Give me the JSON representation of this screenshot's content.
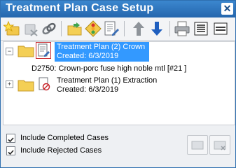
{
  "window": {
    "title": "Treatment Plan Case Setup",
    "close_glyph": "✕"
  },
  "toolbar": {
    "buttons": [
      {
        "name": "new-case-icon"
      },
      {
        "name": "delete-case-icon"
      },
      {
        "name": "link-icon"
      },
      {
        "name": "open-folder-icon"
      },
      {
        "name": "traffic-light-icon"
      },
      {
        "name": "edit-document-icon"
      },
      {
        "name": "move-up-icon"
      },
      {
        "name": "move-down-icon"
      },
      {
        "name": "print-icon"
      },
      {
        "name": "list-view-icon"
      },
      {
        "name": "collapse-icon"
      }
    ]
  },
  "tree": {
    "nodes": [
      {
        "title": "Treatment Plan (2) Crown",
        "created": "Created: 6/3/2019",
        "expanded": true,
        "selected": true,
        "children": [
          {
            "label": "D2750: Crown-porc fuse high noble mtl [#21 ]"
          }
        ]
      },
      {
        "title": "Treatment Plan (1) Extraction",
        "created": "Created: 6/3/2019",
        "expanded": false,
        "selected": false
      }
    ]
  },
  "footer": {
    "include_completed": {
      "label": "Include Completed Cases",
      "checked": true
    },
    "include_rejected": {
      "label": "Include Rejected Cases",
      "checked": true
    }
  },
  "colors": {
    "title_bar": "#2f74bd",
    "selection": "#3399ff",
    "accent_red": "#c8262c"
  }
}
